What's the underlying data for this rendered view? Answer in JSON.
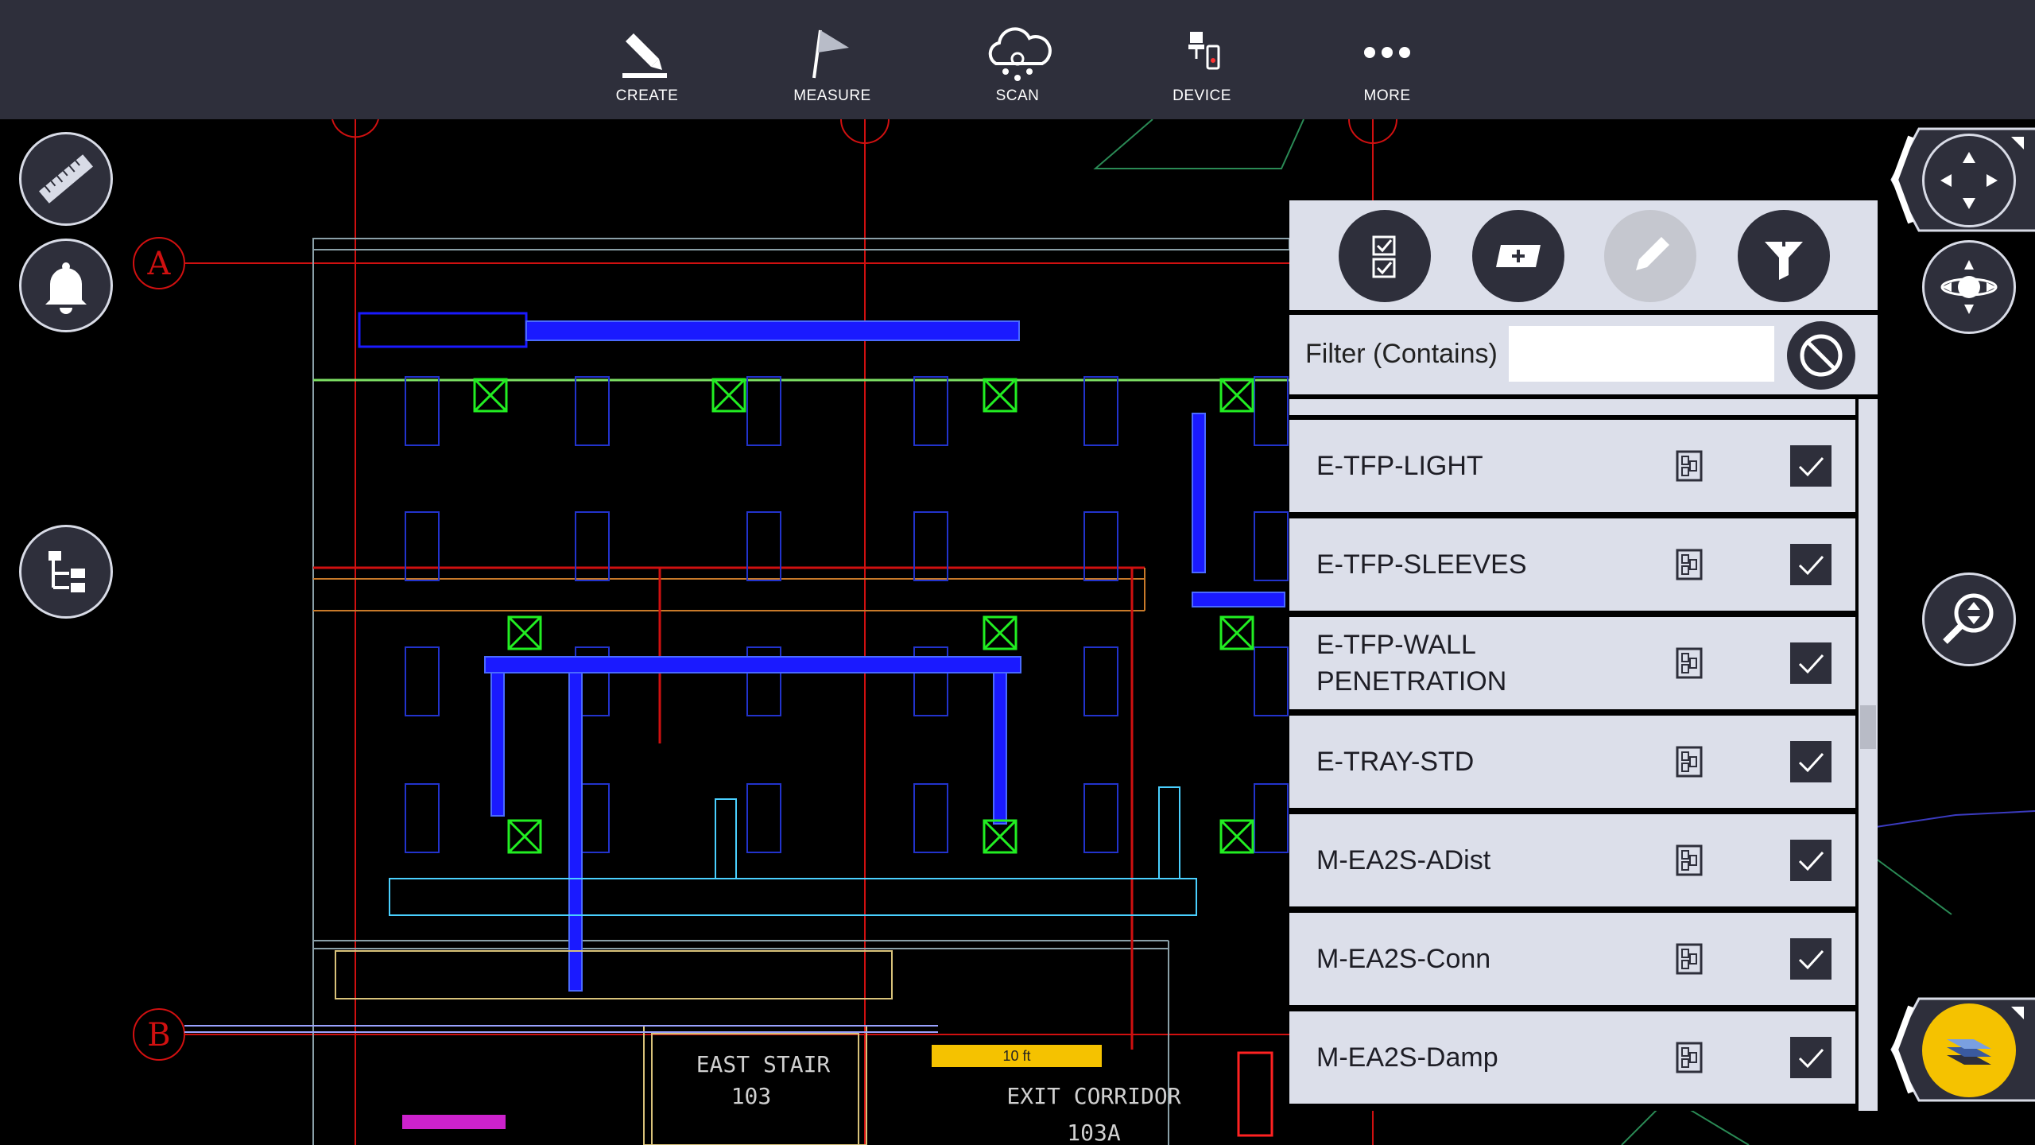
{
  "toolbar": {
    "items": [
      {
        "label": "CREATE",
        "icon": "pencil-icon"
      },
      {
        "label": "MEASURE",
        "icon": "flag-icon"
      },
      {
        "label": "SCAN",
        "icon": "cloud-scan-icon"
      },
      {
        "label": "DEVICE",
        "icon": "device-icon"
      },
      {
        "label": "MORE",
        "icon": "more-icon"
      }
    ]
  },
  "left_tools": [
    {
      "name": "ruler-icon"
    },
    {
      "name": "bell-icon"
    },
    {
      "name": "tree-icon"
    }
  ],
  "right_tools": [
    {
      "name": "pan-icon"
    },
    {
      "name": "orbit-icon"
    },
    {
      "name": "zoom-icon"
    },
    {
      "name": "layers-icon"
    }
  ],
  "panel": {
    "tools": [
      {
        "name": "select-all-icon",
        "enabled": true
      },
      {
        "name": "add-layer-icon",
        "enabled": true
      },
      {
        "name": "edit-icon",
        "enabled": false
      },
      {
        "name": "filter-icon",
        "enabled": true
      }
    ],
    "filter": {
      "label": "Filter (Contains)",
      "value": "",
      "placeholder": ""
    },
    "layers": [
      {
        "name": "E-TFP-LIGHT",
        "checked": true
      },
      {
        "name": "E-TFP-SLEEVES",
        "checked": true
      },
      {
        "name": "E-TFP-WALL PENETRATION",
        "checked": true
      },
      {
        "name": "E-TRAY-STD",
        "checked": true
      },
      {
        "name": "M-EA2S-ADist",
        "checked": true
      },
      {
        "name": "M-EA2S-Conn",
        "checked": true
      },
      {
        "name": "M-EA2S-Damp",
        "checked": true
      }
    ]
  },
  "drawing": {
    "grid_labels": [
      "A",
      "B"
    ],
    "room_labels": [
      {
        "name": "EAST STAIR",
        "number": "103"
      },
      {
        "name": "EXIT CORRIDOR",
        "number": "103A"
      }
    ],
    "scale_bar": "10 ft"
  },
  "colors": {
    "toolbar_bg": "#2e2f3b",
    "panel_bg": "#dcdfea",
    "accent_yellow": "#f5c200",
    "grid_red": "#d01010",
    "duct_blue": "#1a1aff"
  }
}
